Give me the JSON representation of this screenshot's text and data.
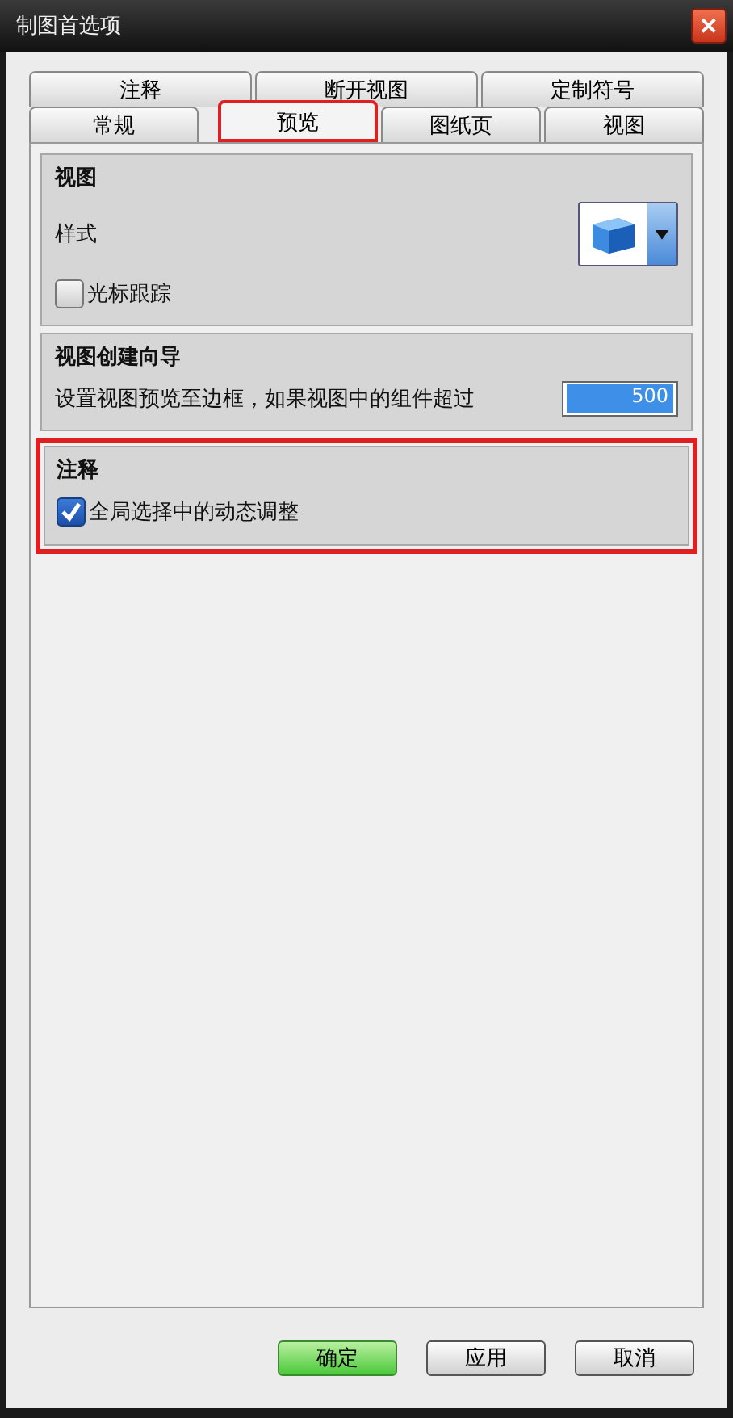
{
  "window": {
    "title": "制图首选项",
    "close": "✕"
  },
  "tab_rows": [
    [
      {
        "label": "注释",
        "selected": false,
        "highlighted": false
      },
      {
        "label": "断开视图",
        "selected": false,
        "highlighted": false
      },
      {
        "label": "定制符号",
        "selected": false,
        "highlighted": false
      }
    ],
    [
      {
        "label": "常规",
        "selected": false,
        "highlighted": false
      },
      {
        "label": "预览",
        "selected": true,
        "highlighted": true
      },
      {
        "label": "图纸页",
        "selected": false,
        "highlighted": false
      },
      {
        "label": "视图",
        "selected": false,
        "highlighted": false
      }
    ]
  ],
  "sections": [
    {
      "title": "视图",
      "highlighted": false,
      "rows": [
        {
          "kind": "style",
          "label": "样式"
        },
        {
          "kind": "checkbox",
          "label": "光标跟踪",
          "checked": false
        }
      ]
    },
    {
      "title": "视图创建向导",
      "highlighted": false,
      "rows": [
        {
          "kind": "number",
          "label": "设置视图预览至边框，如果视图中的组件超过",
          "value": "500"
        }
      ]
    },
    {
      "title": "注释",
      "highlighted": true,
      "rows": [
        {
          "kind": "checkbox",
          "label": "全局选择中的动态调整",
          "checked": true
        }
      ]
    }
  ],
  "buttons": [
    {
      "label": "确定",
      "kind": "primary"
    },
    {
      "label": "应用",
      "kind": "normal"
    },
    {
      "label": "取消",
      "kind": "normal"
    }
  ]
}
